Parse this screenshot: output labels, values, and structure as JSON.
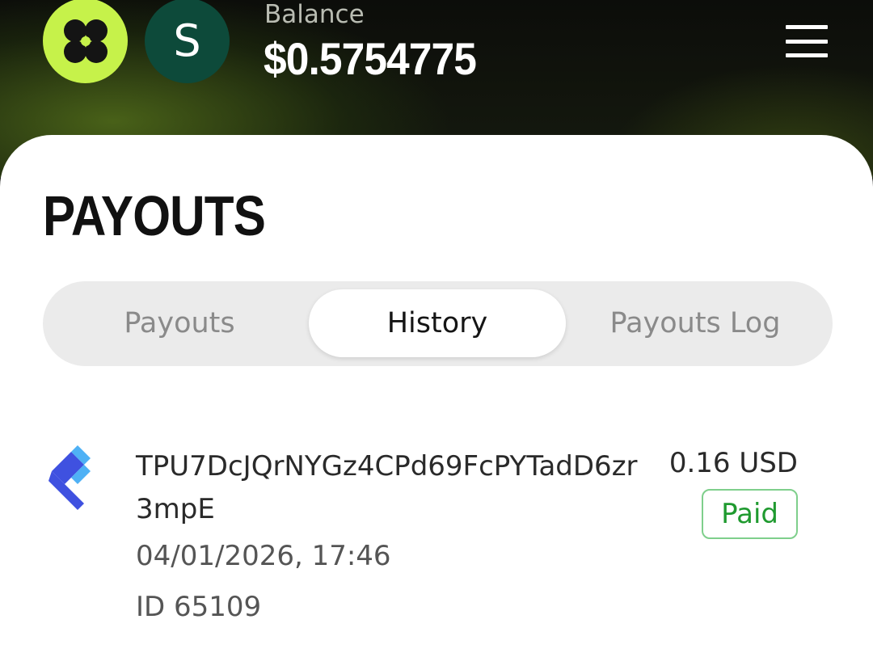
{
  "header": {
    "avatar_initial": "S",
    "balance_label": "Balance",
    "balance_value": "$0.5754775",
    "logo_icon": "clover-icon",
    "menu_icon": "hamburger-menu-icon",
    "colors": {
      "logo_bg": "#c6f24a",
      "avatar_bg": "#0d4a3a"
    }
  },
  "page": {
    "title": "PAYOUTS"
  },
  "tabs": [
    {
      "label": "Payouts",
      "active": false
    },
    {
      "label": "History",
      "active": true
    },
    {
      "label": "Payouts Log",
      "active": false
    }
  ],
  "payouts": [
    {
      "coin_icon": "tron-wallet-icon",
      "address": "TPU7DcJQrNYGz4CPd69FcPYTadD6zr3mpE",
      "datetime": "04/01/2026, 17:46",
      "id_text": "ID 65109",
      "amount": "0.16 USD",
      "status": "Paid",
      "status_color": "#1f9a2f"
    }
  ]
}
